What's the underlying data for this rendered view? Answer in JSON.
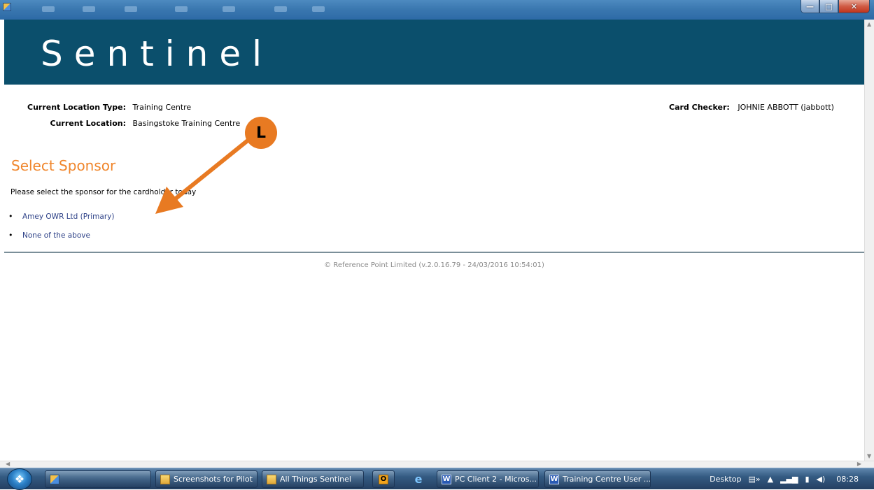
{
  "window": {
    "minimize_glyph": "—",
    "maximize_glyph": "□",
    "close_glyph": "✕"
  },
  "banner": {
    "logo_text": "Sentinel"
  },
  "header_info": {
    "location_type_label": "Current Location Type:",
    "location_type_value": "Training Centre",
    "location_label": "Current Location:",
    "location_value": "Basingstoke Training Centre",
    "card_checker_label": "Card Checker:",
    "card_checker_value": "JOHNIE ABBOTT (jabbott)"
  },
  "main": {
    "title": "Select Sponsor",
    "instruction": "Please select the sponsor for the cardholder today",
    "options": [
      {
        "label": "Amey OWR Ltd (Primary)"
      },
      {
        "label": "None of the above"
      }
    ]
  },
  "footer": {
    "text": "© Reference Point Limited (v.2.0.16.79 - 24/03/2016 10:54:01)"
  },
  "annotation": {
    "letter": "L",
    "color": "#e87a22"
  },
  "taskbar": {
    "items": [
      {
        "label": "Screenshots for Pilot",
        "icon": "folder-icon"
      },
      {
        "label": "All Things Sentinel",
        "icon": "folder-icon"
      },
      {
        "label": "PC Client 2 - Micros...",
        "icon": "word-icon"
      },
      {
        "label": "Training Centre User ...",
        "icon": "word-icon"
      }
    ],
    "tray": {
      "desktop_label": "Desktop",
      "time": "08:28"
    }
  },
  "colors": {
    "banner": "#0b4f6c",
    "title": "#f0862c",
    "link": "#2b3f86"
  }
}
